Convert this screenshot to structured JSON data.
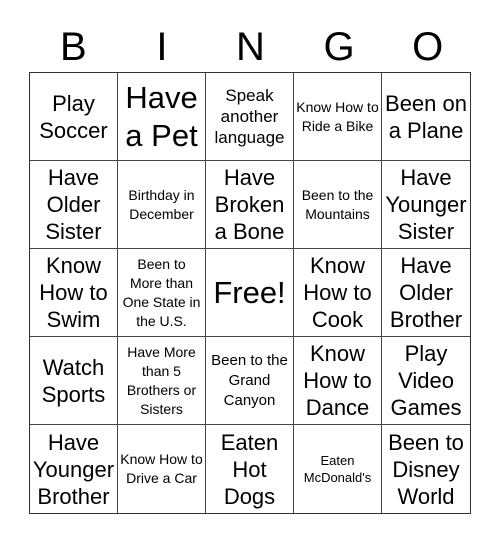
{
  "header": [
    "B",
    "I",
    "N",
    "G",
    "O"
  ],
  "cells": [
    {
      "text": "Play Soccer",
      "size": "s-l"
    },
    {
      "text": "Have a Pet",
      "size": "s-xl"
    },
    {
      "text": "Speak another language",
      "size": "s-m"
    },
    {
      "text": "Know How to Ride a Bike",
      "size": "s-xs"
    },
    {
      "text": "Been on a Plane",
      "size": "s-l"
    },
    {
      "text": "Have Older Sister",
      "size": "s-l"
    },
    {
      "text": "Birthday in December",
      "size": "s-xs"
    },
    {
      "text": "Have Broken a Bone",
      "size": "s-l"
    },
    {
      "text": "Been to the Mountains",
      "size": "s-xs"
    },
    {
      "text": "Have Younger Sister",
      "size": "s-l"
    },
    {
      "text": "Know How to Swim",
      "size": "s-l"
    },
    {
      "text": "Been to More than One State in the U.S.",
      "size": "s-xs"
    },
    {
      "text": "Free!",
      "size": "s-xl"
    },
    {
      "text": "Know How to Cook",
      "size": "s-l"
    },
    {
      "text": "Have Older Brother",
      "size": "s-l"
    },
    {
      "text": "Watch Sports",
      "size": "s-l"
    },
    {
      "text": "Have More than 5 Brothers or Sisters",
      "size": "s-xs"
    },
    {
      "text": "Been to the Grand Canyon",
      "size": "s-s"
    },
    {
      "text": "Know How to Dance",
      "size": "s-l"
    },
    {
      "text": "Play Video Games",
      "size": "s-l"
    },
    {
      "text": "Have Younger Brother",
      "size": "s-l"
    },
    {
      "text": "Know How to Drive a Car",
      "size": "s-xs"
    },
    {
      "text": "Eaten Hot Dogs",
      "size": "s-l"
    },
    {
      "text": "Eaten McDonald's",
      "size": "s-xxs"
    },
    {
      "text": "Been to Disney World",
      "size": "s-l"
    }
  ]
}
